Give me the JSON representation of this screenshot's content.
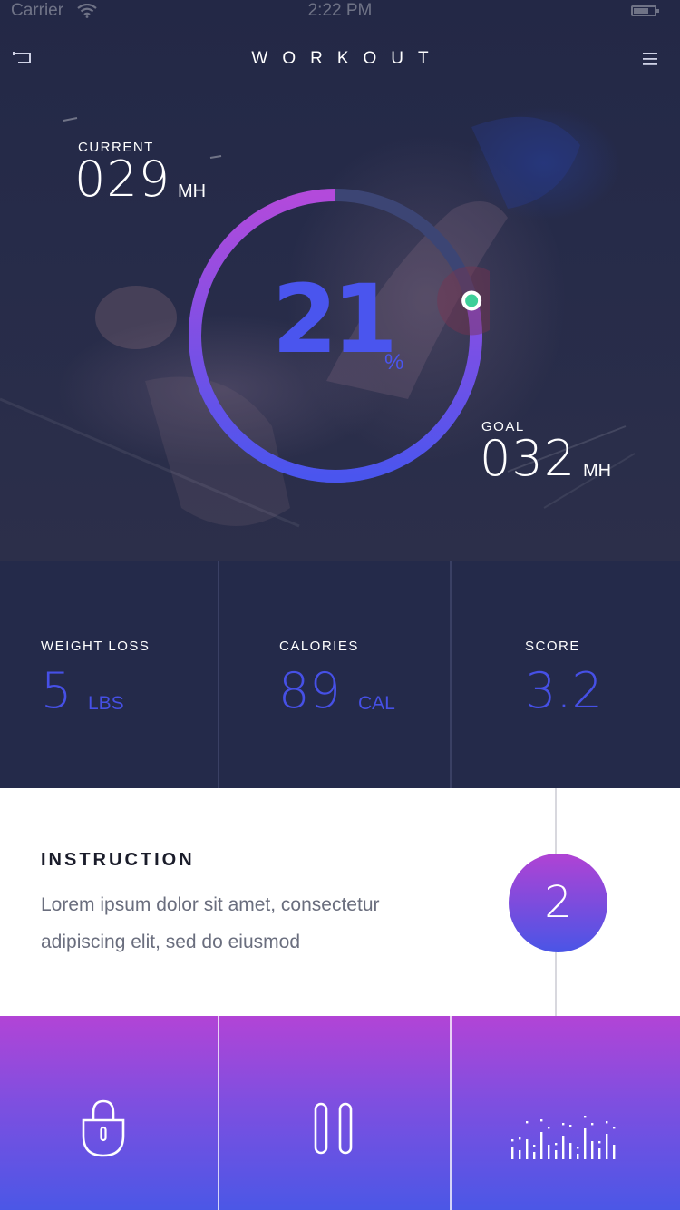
{
  "status_bar": {
    "carrier": "Carrier",
    "time": "2:22 PM"
  },
  "header": {
    "title": "WORKOUT",
    "back_icon": "back-arrow-icon",
    "menu_icon": "hamburger-menu-icon"
  },
  "progress": {
    "current": {
      "label": "CURRENT",
      "value": "029",
      "unit": "MH"
    },
    "goal": {
      "label": "GOAL",
      "value": "032",
      "unit": "MH"
    },
    "percent": {
      "value": "21",
      "unit": "%"
    },
    "fraction": 0.21,
    "colors": {
      "start": "#b34adb",
      "end": "#4a55ee",
      "track": "#3c4574",
      "knob": "#3ecf9a"
    }
  },
  "stats": [
    {
      "label": "WEIGHT LOSS",
      "value": "5",
      "unit": "LBS"
    },
    {
      "label": "CALORIES",
      "value": "89",
      "unit": "CAL"
    },
    {
      "label": "SCORE",
      "value": "3.2",
      "unit": ""
    }
  ],
  "instruction": {
    "title": "INSTRUCTION",
    "line1": "Lorem ipsum dolor sit amet, consectetur",
    "line2": "adipiscing elit, sed do eiusmod",
    "step": "2"
  },
  "controls": [
    {
      "icon": "lock-icon"
    },
    {
      "icon": "pause-icon"
    },
    {
      "icon": "equalizer-icon"
    }
  ],
  "colors": {
    "accent": "#4650e6",
    "hero_bg": "#232846",
    "stats_bg": "#242a4a",
    "gradient_top": "#b244d6",
    "gradient_bottom": "#4b57e6"
  }
}
